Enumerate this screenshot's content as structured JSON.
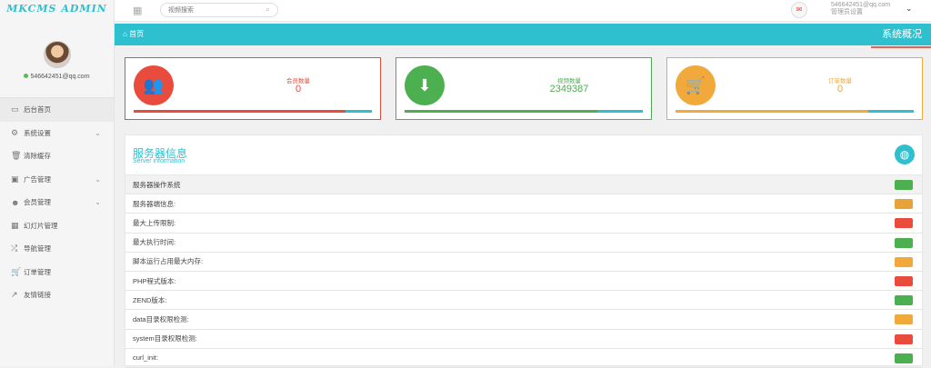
{
  "brand": "MKCMS ADMIN",
  "user": {
    "email": "546642451@qq.com"
  },
  "nav": [
    {
      "label": "后台首页",
      "icon": "monitor-icon",
      "glyph": "▭",
      "chevron": false,
      "active": true
    },
    {
      "label": "系统设置",
      "icon": "gear-icon",
      "glyph": "⚙",
      "chevron": true
    },
    {
      "label": "清除缓存",
      "icon": "trash-icon",
      "glyph": "🗑",
      "chevron": false
    },
    {
      "label": "广告管理",
      "icon": "image-icon",
      "glyph": "▣",
      "chevron": true
    },
    {
      "label": "会员管理",
      "icon": "users-icon",
      "glyph": "☻",
      "chevron": true
    },
    {
      "label": "幻灯片管理",
      "icon": "table-icon",
      "glyph": "▦",
      "chevron": false
    },
    {
      "label": "导航管理",
      "icon": "shuffle-icon",
      "glyph": "⤮",
      "chevron": false
    },
    {
      "label": "订单管理",
      "icon": "cart-icon",
      "glyph": "🛒",
      "chevron": false
    },
    {
      "label": "友情链接",
      "icon": "external-link-icon",
      "glyph": "↗",
      "chevron": false
    }
  ],
  "topbar": {
    "search_placeholder": "视频搜索",
    "user_email": "546642451@qq.com",
    "user_role": "管理员设置"
  },
  "breadcrumb": {
    "home": "首页",
    "title": "系统概况"
  },
  "stats": [
    {
      "label": "会员数量",
      "value": "0",
      "color": "#e94b3c",
      "icon": "users-icon",
      "glyph": "👥",
      "progress": 0.89
    },
    {
      "label": "视频数量",
      "value": "2349387",
      "color": "#4caf50",
      "icon": "download-icon",
      "glyph": "⬇",
      "progress": 0.81
    },
    {
      "label": "订单数量",
      "value": "0",
      "color": "#f0a93a",
      "icon": "cart-icon",
      "glyph": "🛒",
      "progress": 0.81
    }
  ],
  "server": {
    "title": "服务器信息",
    "subtitle": "Server information",
    "rows": [
      {
        "label": "服务器操作系统",
        "badge": "#4caf50"
      },
      {
        "label": "服务器端信息:",
        "badge": "#e8a23a"
      },
      {
        "label": "最大上传限制:",
        "badge": "#e94b3c"
      },
      {
        "label": "最大执行时间:",
        "badge": "#4caf50"
      },
      {
        "label": "脚本运行占用最大内存:",
        "badge": "#f0a93a"
      },
      {
        "label": "PHP程式版本:",
        "badge": "#e94b3c"
      },
      {
        "label": "ZEND版本:",
        "badge": "#4caf50"
      },
      {
        "label": "data目录权限检测:",
        "badge": "#f0a93a"
      },
      {
        "label": "system目录权限检测:",
        "badge": "#e94b3c"
      },
      {
        "label": "curl_init:",
        "badge": "#4caf50"
      }
    ]
  }
}
